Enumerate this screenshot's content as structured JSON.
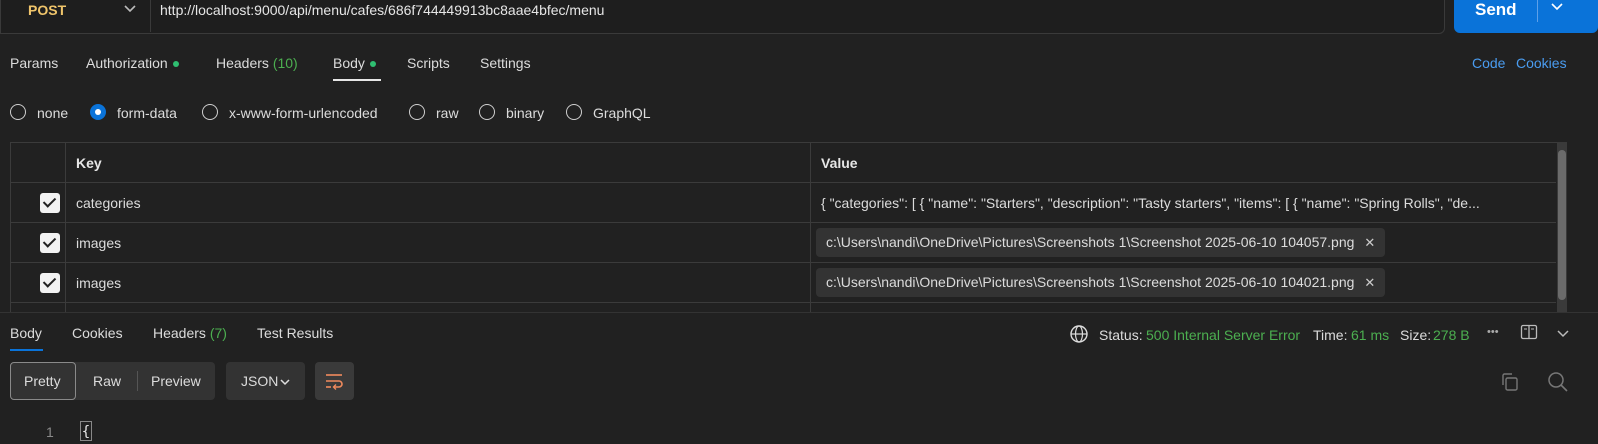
{
  "request": {
    "method": "POST",
    "url": "http://localhost:9000/api/menu/cafes/686f744449913bc8aae4bfec/menu",
    "send_label": "Send"
  },
  "request_tabs": [
    {
      "label": "Params"
    },
    {
      "label": "Authorization",
      "dot": true
    },
    {
      "label": "Headers",
      "count": "(10)"
    },
    {
      "label": "Body",
      "dot": true,
      "active": true
    },
    {
      "label": "Scripts"
    },
    {
      "label": "Settings"
    }
  ],
  "links": {
    "code": "Code",
    "cookies": "Cookies"
  },
  "body_types": [
    {
      "label": "none",
      "selected": false
    },
    {
      "label": "form-data",
      "selected": true
    },
    {
      "label": "x-www-form-urlencoded",
      "selected": false
    },
    {
      "label": "raw",
      "selected": false
    },
    {
      "label": "binary",
      "selected": false
    },
    {
      "label": "GraphQL",
      "selected": false
    }
  ],
  "form_table": {
    "headers": {
      "key": "Key",
      "value": "Value"
    },
    "rows": [
      {
        "checked": true,
        "key": "categories",
        "value": "{ \"categories\": [ { \"name\": \"Starters\", \"description\": \"Tasty starters\", \"items\": [ { \"name\": \"Spring Rolls\", \"de..."
      },
      {
        "checked": true,
        "key": "images",
        "file": "c:\\Users\\nandi\\OneDrive\\Pictures\\Screenshots 1\\Screenshot 2025-06-10 104057.png"
      },
      {
        "checked": true,
        "key": "images",
        "file": "c:\\Users\\nandi\\OneDrive\\Pictures\\Screenshots 1\\Screenshot 2025-06-10 104021.png"
      }
    ]
  },
  "response_tabs": [
    {
      "label": "Body",
      "active": true
    },
    {
      "label": "Cookies"
    },
    {
      "label": "Headers",
      "count": "(7)"
    },
    {
      "label": "Test Results"
    }
  ],
  "response_status": {
    "status_label": "Status:",
    "status_value": "500 Internal Server Error",
    "time_label": "Time:",
    "time_value": "61 ms",
    "size_label": "Size:",
    "size_value": "278 B",
    "more": "•••"
  },
  "view_modes": [
    "Pretty",
    "Raw",
    "Preview"
  ],
  "format": "JSON",
  "editor": {
    "line_number": "1",
    "first_char": "{"
  },
  "colors": {
    "accent": "#0a73d9",
    "method": "#f0c56b",
    "success": "#4caf50",
    "link": "#4a9cf0"
  },
  "icons": [
    "chevron-down-icon",
    "globe-icon",
    "layout-toggle-icon",
    "copy-icon",
    "search-icon",
    "wrap-lines-icon",
    "close-icon"
  ]
}
